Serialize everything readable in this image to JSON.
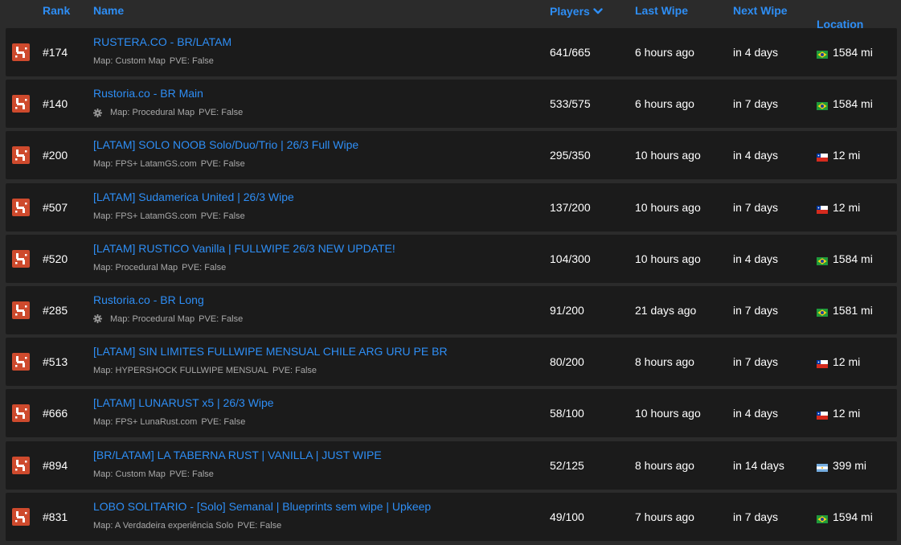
{
  "header": {
    "rank": "Rank",
    "name": "Name",
    "players": "Players",
    "last_wipe": "Last Wipe",
    "next_wipe": "Next Wipe",
    "location": "Location"
  },
  "colors": {
    "accent": "#2e8ef5",
    "row_bg": "#1b1b1b",
    "page_bg": "#2b2b2b",
    "rust_icon": "#ce4a2d"
  },
  "rows": [
    {
      "rank": "#174",
      "name": "RUSTERA.CO - BR/LATAM",
      "map": "Map: Custom Map",
      "pve": "PVE: False",
      "gear": false,
      "players": "641/665",
      "last_wipe": "6 hours ago",
      "next_wipe": "in 4 days",
      "flag": "brazil-flag-icon",
      "distance": "1584 mi"
    },
    {
      "rank": "#140",
      "name": "Rustoria.co - BR Main",
      "map": "Map: Procedural Map",
      "pve": "PVE: False",
      "gear": true,
      "players": "533/575",
      "last_wipe": "6 hours ago",
      "next_wipe": "in 7 days",
      "flag": "brazil-flag-icon",
      "distance": "1584 mi"
    },
    {
      "rank": "#200",
      "name": "[LATAM] SOLO NOOB Solo/Duo/Trio | 26/3 Full Wipe",
      "map": "Map: FPS+ LatamGS.com",
      "pve": "PVE: False",
      "gear": false,
      "players": "295/350",
      "last_wipe": "10 hours ago",
      "next_wipe": "in 4 days",
      "flag": "chile-flag-icon",
      "distance": "12 mi"
    },
    {
      "rank": "#507",
      "name": "[LATAM] Sudamerica United | 26/3 Wipe",
      "map": "Map: FPS+ LatamGS.com",
      "pve": "PVE: False",
      "gear": false,
      "players": "137/200",
      "last_wipe": "10 hours ago",
      "next_wipe": "in 7 days",
      "flag": "chile-flag-icon",
      "distance": "12 mi"
    },
    {
      "rank": "#520",
      "name": "[LATAM] RUSTICO Vanilla | FULLWIPE 26/3 NEW UPDATE!",
      "map": "Map: Procedural Map",
      "pve": "PVE: False",
      "gear": false,
      "players": "104/300",
      "last_wipe": "10 hours ago",
      "next_wipe": "in 4 days",
      "flag": "brazil-flag-icon",
      "distance": "1584 mi"
    },
    {
      "rank": "#285",
      "name": "Rustoria.co - BR Long",
      "map": "Map: Procedural Map",
      "pve": "PVE: False",
      "gear": true,
      "players": "91/200",
      "last_wipe": "21 days ago",
      "next_wipe": "in 7 days",
      "flag": "brazil-flag-icon",
      "distance": "1581 mi"
    },
    {
      "rank": "#513",
      "name": "[LATAM] SIN LIMITES FULLWIPE MENSUAL CHILE ARG URU PE BR",
      "map": "Map: HYPERSHOCK FULLWIPE MENSUAL",
      "pve": "PVE: False",
      "gear": false,
      "players": "80/200",
      "last_wipe": "8 hours ago",
      "next_wipe": "in 7 days",
      "flag": "chile-flag-icon",
      "distance": "12 mi"
    },
    {
      "rank": "#666",
      "name": "[LATAM] LUNARUST x5 | 26/3 Wipe",
      "map": "Map: FPS+ LunaRust.com",
      "pve": "PVE: False",
      "gear": false,
      "players": "58/100",
      "last_wipe": "10 hours ago",
      "next_wipe": "in 4 days",
      "flag": "chile-flag-icon",
      "distance": "12 mi"
    },
    {
      "rank": "#894",
      "name": "[BR/LATAM] LA TABERNA RUST | VANILLA | JUST WIPE",
      "map": "Map: Custom Map",
      "pve": "PVE: False",
      "gear": false,
      "players": "52/125",
      "last_wipe": "8 hours ago",
      "next_wipe": "in 14 days",
      "flag": "argentina-flag-icon",
      "distance": "399 mi"
    },
    {
      "rank": "#831",
      "name": "LOBO SOLITARIO - [Solo] Semanal | Blueprints sem wipe | Upkeep",
      "map": "Map: A Verdadeira experiência Solo",
      "pve": "PVE: False",
      "gear": false,
      "players": "49/100",
      "last_wipe": "7 hours ago",
      "next_wipe": "in 7 days",
      "flag": "brazil-flag-icon",
      "distance": "1594 mi"
    }
  ]
}
